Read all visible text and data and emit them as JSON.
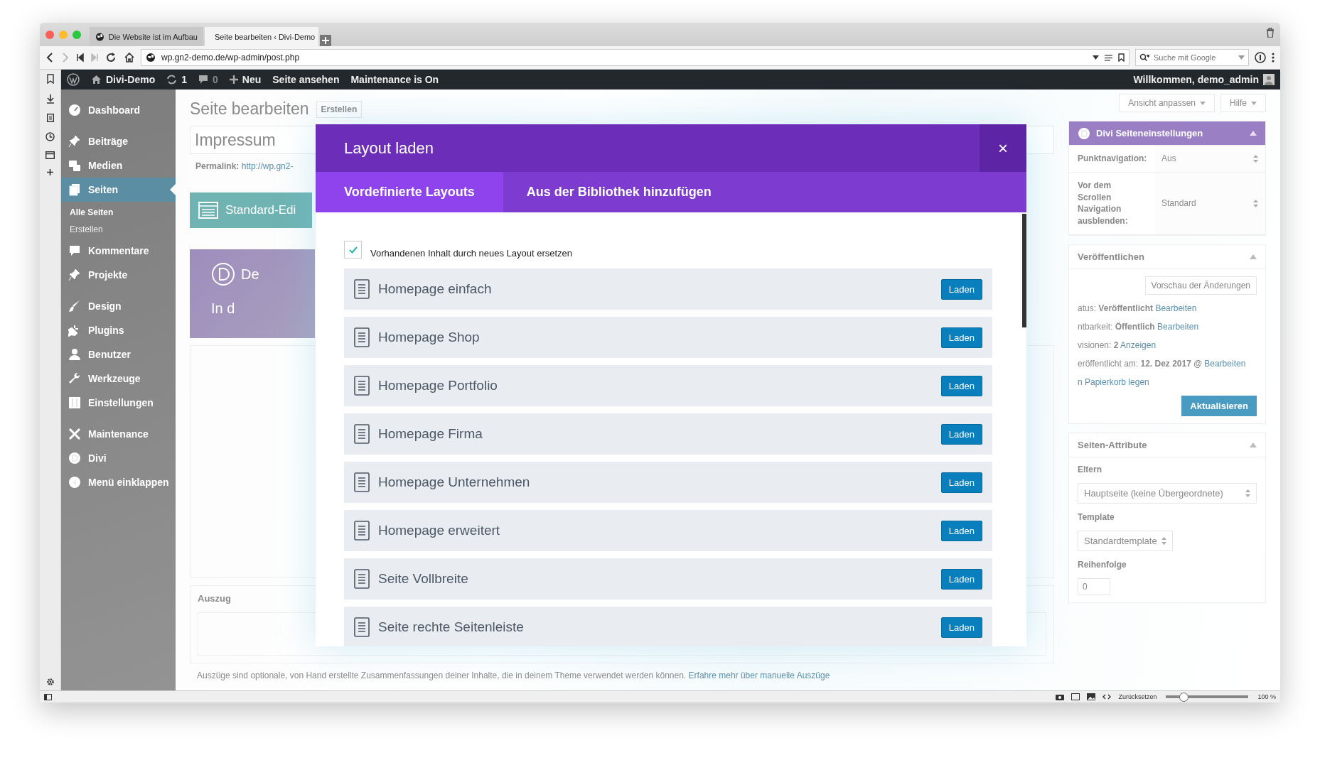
{
  "browser": {
    "tabs": [
      {
        "label": "Die Website ist im Aufbau",
        "selected": false
      },
      {
        "label": "Seite bearbeiten ‹ Divi-Demo",
        "selected": true
      }
    ],
    "address": "wp.gn2-demo.de/wp-admin/post.php",
    "search": {
      "placeholder": "Suche mit Google"
    }
  },
  "admin_bar": {
    "site": "Divi-Demo",
    "updates": "1",
    "comments": "0",
    "new": "Neu",
    "links": [
      "Seite ansehen",
      "Maintenance is On"
    ],
    "account": "Willkommen, demo_admin"
  },
  "menu": [
    [
      {
        "label": "Dashboard",
        "kind": "dashboard",
        "selected": false
      }
    ],
    [
      {
        "label": "Beiträge",
        "kind": "pin",
        "selected": false
      },
      {
        "label": "Medien",
        "kind": "media",
        "selected": false
      },
      {
        "label": "Seiten",
        "kind": "pages",
        "selected": true,
        "children": [
          {
            "label": "Alle Seiten",
            "selected": true
          },
          {
            "label": "Erstellen",
            "selected": false
          }
        ]
      },
      {
        "label": "Kommentare",
        "kind": "comment",
        "selected": false
      },
      {
        "label": "Projekte",
        "kind": "pin",
        "selected": false
      }
    ],
    [
      {
        "label": "Design",
        "kind": "brush",
        "selected": false
      },
      {
        "label": "Plugins",
        "kind": "plug",
        "selected": false
      },
      {
        "label": "Benutzer",
        "kind": "user",
        "selected": false
      },
      {
        "label": "Werkzeuge",
        "kind": "wrench",
        "selected": false
      },
      {
        "label": "Einstellungen",
        "kind": "sliders",
        "selected": false
      }
    ],
    [
      {
        "label": "Maintenance",
        "kind": "tools",
        "selected": false
      },
      {
        "label": "Divi",
        "kind": "divi",
        "selected": false
      },
      {
        "label": "Menü einklappen",
        "kind": "collapse",
        "selected": false
      }
    ]
  ],
  "screen_options": [
    "Ansicht anpassen",
    "Hilfe"
  ],
  "editor": {
    "heading": "Seite bearbeiten",
    "add_button": "Erstellen",
    "title_value": "Impressum",
    "permalink_label": "Permalink:",
    "permalink_link": "http://wp.gn2-",
    "editor_button": "Standard-Edi",
    "builder_title": "De",
    "builder_text": "In d"
  },
  "excerpt": {
    "title": "Auszug",
    "help": "Auszüge sind optionale, von Hand erstellte Zusammenfassungen deiner Inhalte, die in deinem Theme verwendet werden können.",
    "link": "Erfahre mehr über manuelle Auszüge"
  },
  "divi_settings": {
    "title": "Divi Seiteneinstellungen",
    "fields": [
      {
        "label": "Punktnavigation:",
        "value": "Aus"
      },
      {
        "label": "Vor dem Scrollen Navigation ausblenden:",
        "value": "Standard"
      }
    ]
  },
  "publish": {
    "title": "Veröffentlichen",
    "preview": "Vorschau der Änderungen",
    "lines": [
      {
        "text": "atus: **Veröffentlicht**",
        "link": "Bearbeiten"
      },
      {
        "text": "ntbarkeit: **Öffentlich**",
        "link": "Bearbeiten"
      },
      {
        "text": "visionen: **2**",
        "link": "Anzeigen"
      },
      {
        "text": "eröffentlicht am: **12. Dez 2017 @**",
        "link": "Bearbeiten"
      }
    ],
    "trash": "n Papierkorb legen",
    "update": "Aktualisieren"
  },
  "attributes": {
    "title": "Seiten-Attribute",
    "parent_label": "Eltern",
    "parent_value": "Hauptseite (keine Übergeordnete)",
    "template_label": "Template",
    "template_value": "Standardtemplate",
    "order_label": "Reihenfolge",
    "order_value": "0"
  },
  "modal": {
    "title": "Layout laden",
    "close": "×",
    "tabs": [
      {
        "label": "Vordefinierte Layouts",
        "selected": true
      },
      {
        "label": "Aus der Bibliothek hinzufügen",
        "selected": false
      }
    ],
    "replace": {
      "label": "Vorhandenen Inhalt durch neues Layout ersetzen",
      "checked": true
    },
    "layouts": [
      {
        "name": "Homepage einfach",
        "button": "Laden"
      },
      {
        "name": "Homepage Shop",
        "button": "Laden"
      },
      {
        "name": "Homepage Portfolio",
        "button": "Laden"
      },
      {
        "name": "Homepage Firma",
        "button": "Laden"
      },
      {
        "name": "Homepage Unternehmen",
        "button": "Laden"
      },
      {
        "name": "Homepage erweitert",
        "button": "Laden"
      },
      {
        "name": "Seite Vollbreite",
        "button": "Laden"
      },
      {
        "name": "Seite rechte Seitenleiste",
        "button": "Laden"
      }
    ]
  },
  "status_bar": {
    "reset": "Zurücksetzen",
    "zoom": {
      "level": 0.2
    },
    "zoom_text": "100 %"
  }
}
